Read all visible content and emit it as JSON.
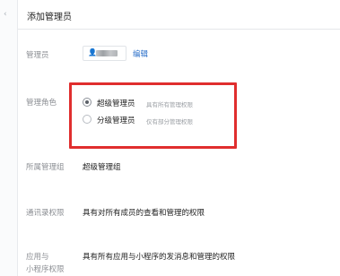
{
  "header": {
    "title": "添加管理员"
  },
  "rows": {
    "admin": {
      "label": "管理员",
      "edit_link": "编辑"
    },
    "role": {
      "label": "管理角色",
      "options": [
        {
          "name": "超级管理员",
          "desc": "具有所有管理权限",
          "selected": true
        },
        {
          "name": "分级管理员",
          "desc": "仅有部分管理权限",
          "selected": false
        }
      ]
    },
    "group": {
      "label": "所属管理组",
      "value": "超级管理组"
    },
    "contacts": {
      "label": "通讯录权限",
      "value": "具有对所有成员的查看和管理的权限"
    },
    "apps": {
      "label_line1": "应用与",
      "label_line2": "小程序权限",
      "value": "具有所有应用与小程序的发消息和管理的权限"
    }
  },
  "colors": {
    "highlight": "#e02e2e",
    "link": "#2a6fc9"
  },
  "icons": {
    "admin_chip": "user-icon"
  }
}
